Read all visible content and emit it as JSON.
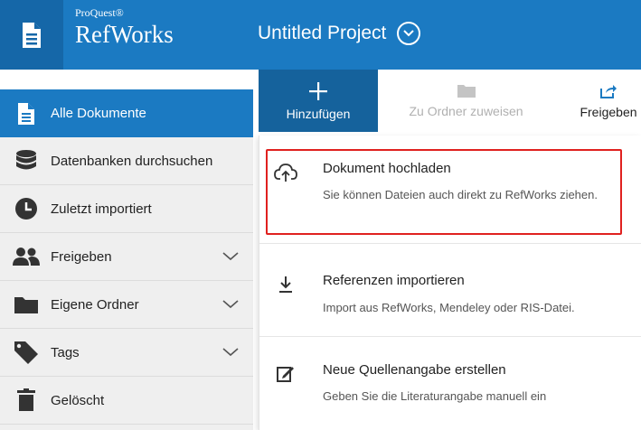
{
  "header": {
    "brand_small": "ProQuest®",
    "brand_big": "RefWorks",
    "project_title": "Untitled Project"
  },
  "sidebar": {
    "items": [
      {
        "label": "Alle Dokumente",
        "icon": "document-icon",
        "active": true
      },
      {
        "label": "Datenbanken durchsuchen",
        "icon": "database-icon"
      },
      {
        "label": "Zuletzt importiert",
        "icon": "clock-icon"
      },
      {
        "label": "Freigeben",
        "icon": "users-icon",
        "expandable": true
      },
      {
        "label": "Eigene Ordner",
        "icon": "folder-icon",
        "expandable": true
      },
      {
        "label": "Tags",
        "icon": "tag-icon",
        "expandable": true
      },
      {
        "label": "Gelöscht",
        "icon": "trash-icon"
      }
    ]
  },
  "toolbar": {
    "add_label": "Hinzufügen",
    "folder_label": "Zu Ordner zuweisen",
    "share_label": "Freigeben"
  },
  "menu": {
    "upload_title": "Dokument hochladen",
    "upload_desc": "Sie können Dateien auch direkt zu RefWorks ziehen.",
    "import_title": "Referenzen importieren",
    "import_desc": "Import aus RefWorks, Mendeley oder RIS-Datei.",
    "create_title": "Neue Quellenangabe erstellen",
    "create_desc": "Geben Sie die Literaturangabe manuell ein"
  },
  "colors": {
    "brand_blue": "#1b7ac2",
    "dark_blue": "#15629c",
    "highlight_red": "#e0211f"
  }
}
